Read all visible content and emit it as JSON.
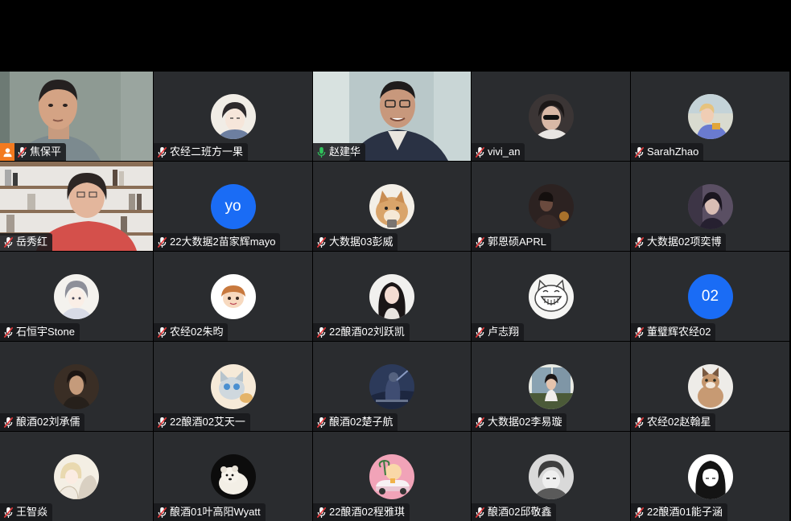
{
  "meeting": {
    "participants": [
      {
        "name": "焦保平",
        "avatar": "video-man-beige-wall",
        "host": true,
        "speaking": false
      },
      {
        "name": "农经二班方一果",
        "avatar": "anime-boy-sketch",
        "host": false,
        "speaking": false
      },
      {
        "name": "赵建华",
        "avatar": "video-man-glasses-curtain",
        "host": false,
        "speaking": true
      },
      {
        "name": "vivi_an",
        "avatar": "photo-woman-sunglasses",
        "host": false,
        "speaking": false
      },
      {
        "name": "SarahZhao",
        "avatar": "photo-girl-outdoor",
        "host": false,
        "speaking": false
      },
      {
        "name": "岳秀红",
        "avatar": "video-woman-bookshelf",
        "host": false,
        "speaking": false
      },
      {
        "name": "22大数据2苗家辉mayo",
        "avatar": "initials",
        "initials": "yo",
        "host": false,
        "speaking": false
      },
      {
        "name": "大数据03彭威",
        "avatar": "photo-shiba-dog",
        "host": false,
        "speaking": false
      },
      {
        "name": "郭恩硕APRL",
        "avatar": "photo-dark-portrait",
        "host": false,
        "speaking": false
      },
      {
        "name": "大数据02项奕博",
        "avatar": "photo-dark-woman",
        "host": false,
        "speaking": false
      },
      {
        "name": "石恒宇Stone",
        "avatar": "anime-character-white",
        "host": false,
        "speaking": false
      },
      {
        "name": "农经02朱昀",
        "avatar": "cartoon-face",
        "host": false,
        "speaking": false
      },
      {
        "name": "22酿酒02刘跃凯",
        "avatar": "photo-woman-long-hair",
        "host": false,
        "speaking": false
      },
      {
        "name": "卢志翔",
        "avatar": "cartoon-cat-smile",
        "host": false,
        "speaking": false
      },
      {
        "name": "董璧辉农经02",
        "avatar": "initials",
        "initials": "02",
        "host": false,
        "speaking": false
      },
      {
        "name": "酿酒02刘承儒",
        "avatar": "photo-man-dark",
        "host": false,
        "speaking": false
      },
      {
        "name": "22酿酒02艾天一",
        "avatar": "cartoon-cat-blue",
        "host": false,
        "speaking": false
      },
      {
        "name": "酿酒02楚子航",
        "avatar": "photo-knight-dark",
        "host": false,
        "speaking": false
      },
      {
        "name": "大数据02李易璇",
        "avatar": "photo-girl-window",
        "host": false,
        "speaking": false
      },
      {
        "name": "农经02赵翰星",
        "avatar": "photo-cat",
        "host": false,
        "speaking": false
      },
      {
        "name": "王智焱",
        "avatar": "anime-collage",
        "host": false,
        "speaking": false
      },
      {
        "name": "酿酒01叶高阳Wyatt",
        "avatar": "photo-bear-dark",
        "host": false,
        "speaking": false
      },
      {
        "name": "22酿酒02程雅琪",
        "avatar": "cartoon-pink-car",
        "host": false,
        "speaking": false
      },
      {
        "name": "酿酒02邱敬鑫",
        "avatar": "anime-boy-gray",
        "host": false,
        "speaking": false
      },
      {
        "name": "22酿酒01能子涵",
        "avatar": "anime-girl-black-hair",
        "host": false,
        "speaking": false
      }
    ]
  },
  "colors": {
    "tile_bg": "#2a2c2f",
    "host_badge": "#f37a1f",
    "speaking_outline": "#2fc25b",
    "initials_bg": "#1a6cf5",
    "mic_muted": "#ffffff",
    "mic_active": "#2fc25b",
    "mic_slash": "#e5393b"
  },
  "icons": {
    "host": "host-person-icon",
    "muted": "microphone-muted-icon",
    "speaking": "microphone-active-icon"
  }
}
